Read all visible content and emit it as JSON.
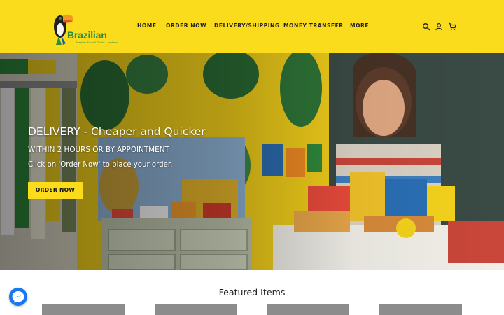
{
  "header": {
    "logo_text": "Brazilian",
    "logo_tagline": "Brazilian Food & Drinks · Anytime",
    "nav": [
      {
        "label": "HOME"
      },
      {
        "label": "ORDER NOW"
      },
      {
        "label": "DELIVERY/SHIPPING"
      },
      {
        "label": "MONEY TRANSFER"
      },
      {
        "label": "MORE"
      }
    ],
    "icons": [
      "search-icon",
      "account-icon",
      "cart-icon"
    ],
    "background_color": "#fbdc1c"
  },
  "hero": {
    "title": "DELIVERY - Cheaper and Quicker",
    "subtitle": "WITHIN 2 HOURS OR BY APPOINTMENT",
    "body": "Click on 'Order Now' to place your order.",
    "button_label": "ORDER NOW",
    "button_color": "#fbdc1c"
  },
  "featured": {
    "title": "Featured Items"
  },
  "widgets": {
    "chat_icon": "messenger-icon",
    "chat_color": "#1877f2"
  }
}
